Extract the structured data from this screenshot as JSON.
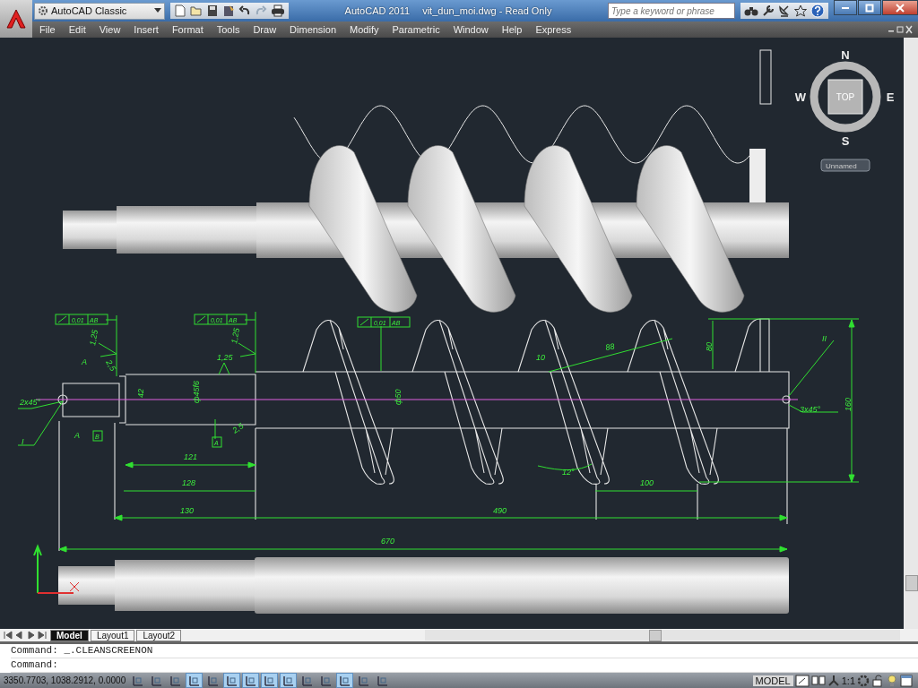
{
  "window": {
    "workspace": "AutoCAD Classic",
    "app_name": "AutoCAD 2011",
    "document": "vit_dun_moi.dwg - Read Only"
  },
  "search": {
    "placeholder": "Type a keyword or phrase"
  },
  "menus": [
    "File",
    "Edit",
    "View",
    "Insert",
    "Format",
    "Tools",
    "Draw",
    "Dimension",
    "Modify",
    "Parametric",
    "Window",
    "Help",
    "Express"
  ],
  "viewcube": {
    "north": "N",
    "south": "S",
    "east": "E",
    "west": "W",
    "face": "TOP",
    "ucs_menu": "Unnamed"
  },
  "annotations": [
    {
      "kind": "frame",
      "text": "0,01",
      "datum": "AB"
    },
    {
      "kind": "frame",
      "text": "0,01",
      "datum": "AB"
    },
    {
      "kind": "frame",
      "text": "0,01",
      "datum": "AB"
    },
    {
      "kind": "text",
      "text": "1,25"
    },
    {
      "kind": "text",
      "text": "1,25"
    },
    {
      "kind": "text",
      "text": "1,25"
    },
    {
      "kind": "text",
      "text": "A"
    },
    {
      "kind": "text",
      "text": "2,5"
    },
    {
      "kind": "text",
      "text": "2x45°"
    },
    {
      "kind": "text",
      "text": "I"
    },
    {
      "kind": "text",
      "text": "A"
    },
    {
      "kind": "datum",
      "text": "B"
    },
    {
      "kind": "text",
      "text": "42"
    },
    {
      "kind": "text",
      "text": "ф45f6"
    },
    {
      "kind": "datum",
      "text": "A"
    },
    {
      "kind": "text",
      "text": "2,5"
    },
    {
      "kind": "text",
      "text": "121"
    },
    {
      "kind": "text",
      "text": "128"
    },
    {
      "kind": "text",
      "text": "130"
    },
    {
      "kind": "text",
      "text": "ф50"
    },
    {
      "kind": "text",
      "text": "490"
    },
    {
      "kind": "text",
      "text": "670"
    },
    {
      "kind": "text",
      "text": "10"
    },
    {
      "kind": "text",
      "text": "88"
    },
    {
      "kind": "text",
      "text": "80"
    },
    {
      "kind": "text",
      "text": "12°"
    },
    {
      "kind": "text",
      "text": "100"
    },
    {
      "kind": "text",
      "text": "II"
    },
    {
      "kind": "text",
      "text": "3x45°"
    },
    {
      "kind": "text",
      "text": "160"
    }
  ],
  "layout_tabs": [
    {
      "label": "Model",
      "selected": true
    },
    {
      "label": "Layout1",
      "selected": false
    },
    {
      "label": "Layout2",
      "selected": false
    }
  ],
  "command_lines": [
    "Command:  _.CLEANSCREENON",
    "Command:"
  ],
  "status_bar": {
    "coordinates": "3350.7703, 1038.2912, 0.0000",
    "toggles": [
      {
        "on": false
      },
      {
        "on": false
      },
      {
        "on": false
      },
      {
        "on": true
      },
      {
        "on": false
      },
      {
        "on": true
      },
      {
        "on": true
      },
      {
        "on": true
      },
      {
        "on": true
      },
      {
        "on": false
      },
      {
        "on": false
      },
      {
        "on": true
      },
      {
        "on": false
      },
      {
        "on": false
      }
    ],
    "space": "MODEL",
    "annotation_scale": "1:1"
  }
}
